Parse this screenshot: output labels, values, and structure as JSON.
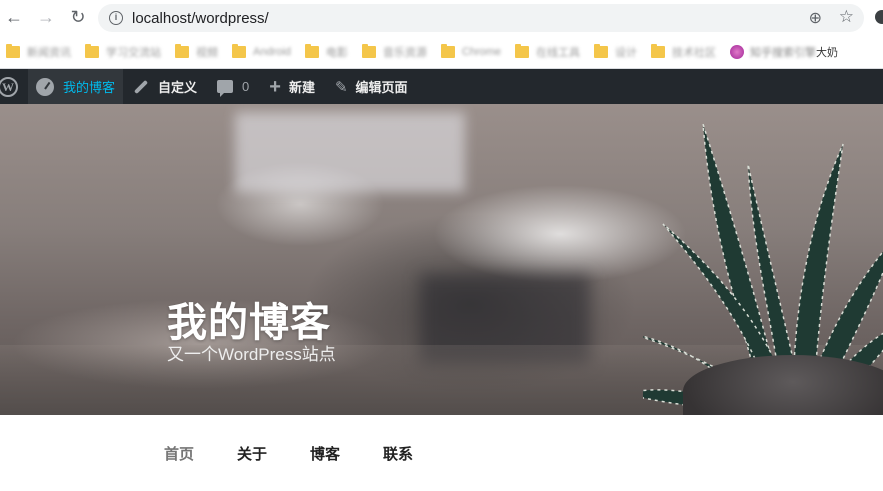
{
  "browser": {
    "url": "localhost/wordpress/",
    "bookmarks": [
      {
        "label": "新闻资讯"
      },
      {
        "label": "学习交流站"
      },
      {
        "label": "视频"
      },
      {
        "label": "Android"
      },
      {
        "label": "电影"
      },
      {
        "label": "音乐资源"
      },
      {
        "label": "Chrome"
      },
      {
        "label": "在线工具"
      },
      {
        "label": "设计"
      },
      {
        "label": "技术社区"
      }
    ],
    "last_bookmark_blurred": "知乎搜索引擎",
    "last_bookmark_visible": "大奶"
  },
  "adminbar": {
    "site_name": "我的博客",
    "customize": "自定义",
    "comments": "0",
    "new": "新建",
    "edit_page": "编辑页面"
  },
  "site": {
    "title": "我的博客",
    "description": "又一个WordPress站点"
  },
  "menu": {
    "items": [
      {
        "label": "首页",
        "current": true
      },
      {
        "label": "关于",
        "current": false
      },
      {
        "label": "博客",
        "current": false
      },
      {
        "label": "联系",
        "current": false
      }
    ]
  },
  "colors": {
    "adminbar_bg": "#23282d",
    "site_link": "#00b9eb",
    "bookmark_folder": "#f4c64a"
  }
}
